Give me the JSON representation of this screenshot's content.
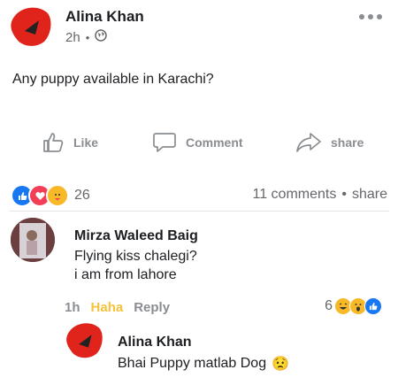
{
  "post": {
    "author": "Alina Khan",
    "time": "2h",
    "separator": "•",
    "text": "Any puppy available in Karachi?"
  },
  "actions": {
    "like": "Like",
    "comment": "Comment",
    "share": "share"
  },
  "summary": {
    "reaction_count": "26",
    "comments": "11 comments",
    "separator": "•",
    "share": "share"
  },
  "comment": {
    "author": "Mirza Waleed Baig",
    "lines": [
      "Flying kiss chalegi?",
      "i am from lahore"
    ],
    "time": "1h",
    "reaction_label": "Haha",
    "reply_label": "Reply",
    "reaction_count": "6"
  },
  "reply": {
    "author": "Alina Khan",
    "text": "Bhai Puppy matlab Dog",
    "emoji": "😟"
  },
  "colors": {
    "like_blue": "#1877f2",
    "love_red": "#f33e58",
    "haha_yellow": "#f7b928",
    "avatar_red": "#e0241c"
  }
}
